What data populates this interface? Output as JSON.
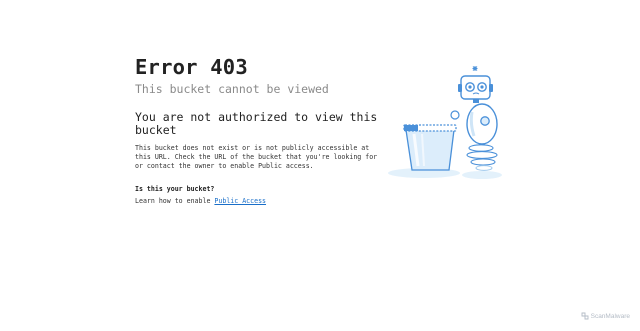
{
  "error": {
    "title": "Error 403",
    "subtitle": "This bucket cannot be viewed",
    "heading": "You are not authorized to view this bucket",
    "description": "This bucket does not exist or is not publicly accessible at this URL. Check the URL of the bucket that you're looking for or contact the owner to enable Public access.",
    "question": "Is this your bucket?",
    "learn_prefix": "Learn how to enable ",
    "learn_link": "Public Access"
  },
  "brand": {
    "label": "ScanMalware"
  },
  "colors": {
    "accent": "#1a6fc9",
    "illustration_blue": "#4a90d9",
    "illustration_light": "#d9ecfa"
  }
}
